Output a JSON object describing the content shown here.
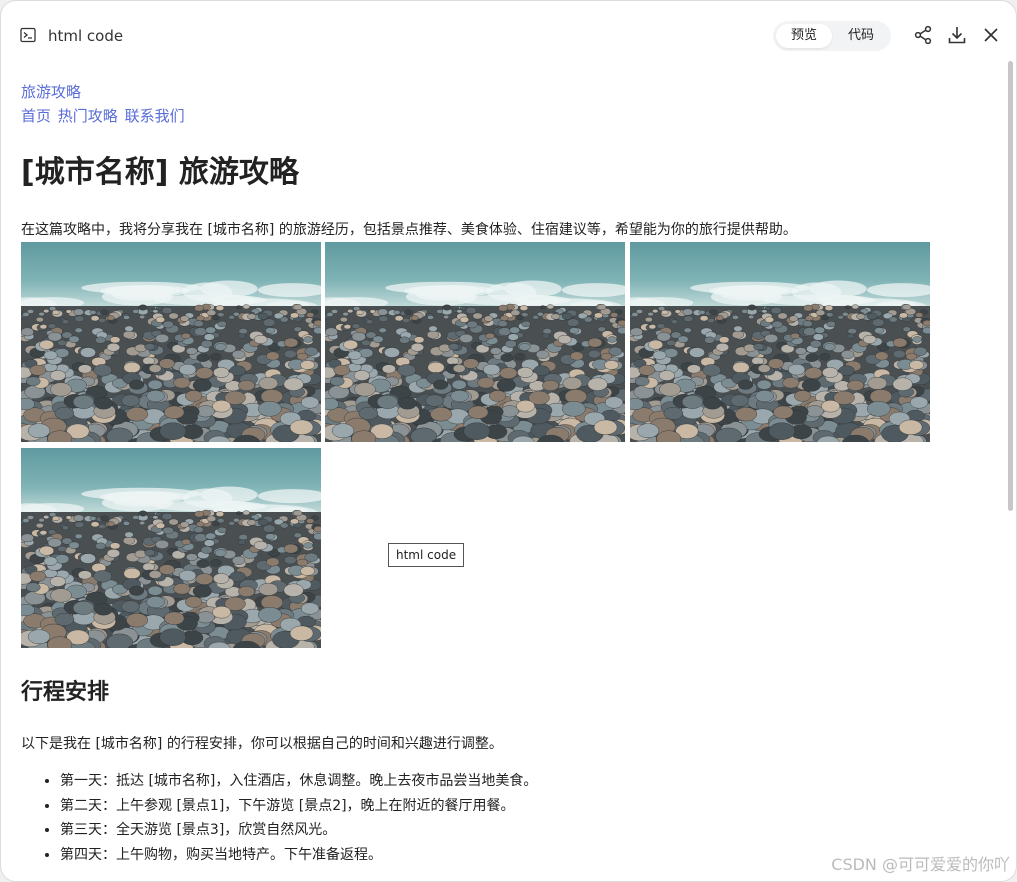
{
  "window": {
    "title": "html code",
    "toggle": {
      "preview": "预览",
      "code": "代码"
    }
  },
  "page": {
    "site_title": "旅游攻略",
    "nav": [
      "首页",
      "热门攻略",
      "联系我们"
    ],
    "h1": "[城市名称] 旅游攻略",
    "intro": "在这篇攻略中，我将分享我在 [城市名称] 的旅游经历，包括景点推荐、美食体验、住宿建议等，希望能为你的旅行提供帮助。",
    "tooltip": "html code",
    "itinerary_title": "行程安排",
    "itinerary_intro": "以下是我在 [城市名称] 的行程安排，你可以根据自己的时间和兴趣进行调整。",
    "itinerary": [
      "第一天：抵达 [城市名称]，入住酒店，休息调整。晚上去夜市品尝当地美食。",
      "第二天：上午参观 [景点1]，下午游览 [景点2]，晚上在附近的餐厅用餐。",
      "第三天：全天游览 [景点3]，欣赏自然风光。",
      "第四天：上午购物，购买当地特产。下午准备返程。"
    ]
  },
  "watermark": "CSDN @可可爱爱的你吖",
  "colors": {
    "link": "#5a6dd8"
  }
}
